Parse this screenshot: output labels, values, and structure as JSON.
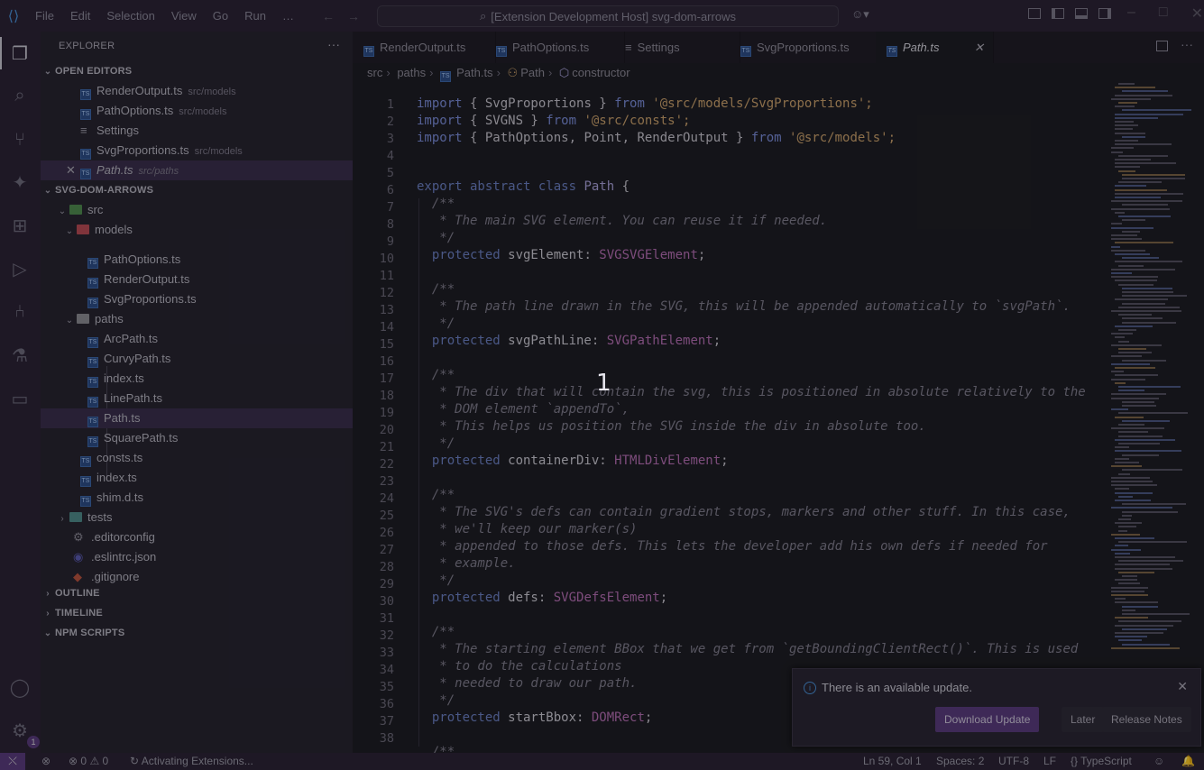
{
  "titlebar": {
    "menu": [
      "File",
      "Edit",
      "Selection",
      "View",
      "Go",
      "Run",
      "…"
    ],
    "search": "[Extension Development Host] svg-dom-arrows"
  },
  "explorer": {
    "title": "EXPLORER",
    "open_editors_label": "OPEN EDITORS",
    "open_editors": [
      {
        "name": "RenderOutput.ts",
        "path": "src/models"
      },
      {
        "name": "PathOptions.ts",
        "path": "src/models"
      },
      {
        "name": "Settings",
        "path": ""
      },
      {
        "name": "SvgProportions.ts",
        "path": "src/models"
      },
      {
        "name": "Path.ts",
        "path": "src/paths"
      }
    ],
    "project_label": "SVG-DOM-ARROWS",
    "tree": {
      "src": "src",
      "models": "models",
      "models_files": [
        "PathOptions.ts",
        "RenderOutput.ts",
        "SvgProportions.ts"
      ],
      "paths": "paths",
      "paths_files": [
        "ArcPath.ts",
        "CurvyPath.ts",
        "index.ts",
        "LinePath.ts",
        "Path.ts",
        "SquarePath.ts"
      ],
      "src_files": [
        "consts.ts",
        "index.ts",
        "shim.d.ts"
      ],
      "tests": "tests",
      "root_files": [
        ".editorconfig",
        ".eslintrc.json",
        ".gitignore"
      ]
    },
    "outline": "OUTLINE",
    "timeline": "TIMELINE",
    "npm_scripts": "NPM SCRIPTS"
  },
  "tabs": [
    {
      "label": "RenderOutput.ts"
    },
    {
      "label": "PathOptions.ts"
    },
    {
      "label": "Settings"
    },
    {
      "label": "SvgProportions.ts"
    },
    {
      "label": "Path.ts"
    }
  ],
  "breadcrumb": [
    "src",
    "paths",
    "Path.ts",
    "Path",
    "constructor"
  ],
  "code": {
    "line_numbers": [
      "1",
      "2",
      "3",
      "4",
      "5",
      "6",
      "7",
      "8",
      "9",
      "10",
      "11",
      "12",
      "13",
      "14",
      "15",
      "16",
      "17",
      "18",
      "19",
      "20",
      "21",
      "22",
      "23",
      "24",
      "25",
      "26",
      "27",
      "28",
      "29",
      "30",
      "31",
      "32",
      "33",
      "34",
      "35",
      "36",
      "37",
      "38"
    ],
    "l1": [
      "import",
      " { SvgProportions } ",
      "from",
      " '@src/models/SvgProportions';"
    ],
    "l2": [
      "import",
      " { SVGNS } ",
      "from",
      " '@src/consts';"
    ],
    "l3": [
      "import",
      " { PathOptions, Point, RenderOutput } ",
      "from",
      " '@src/models';"
    ],
    "l5": [
      "export",
      " abstract",
      " class",
      " Path",
      " {"
    ],
    "c6": "  /**",
    "c7": "   * The main SVG element. You can reuse it if needed.",
    "c8": "   */",
    "p9": [
      "  protected",
      " svgElement",
      ": ",
      "SVGSVGElement",
      ";"
    ],
    "c11": "  /**",
    "c12": "   * The path line drawn in the SVG, this will be appended automatically to `svgPath`.",
    "c13": "   */",
    "p14": [
      "  protected",
      " svgPathLine",
      ": ",
      "SVGPathElement",
      ";"
    ],
    "c16": "  /**",
    "c17": "   * The div that will contain the svg, this is positioned in absolute relatively to the",
    "c18": "   * DOM element `appendTo`,",
    "c19": "   * This helps us position the SVG inside the div in absolute too.",
    "c20": "   */",
    "p21": [
      "  protected",
      " containerDiv",
      ": ",
      "HTMLDivElement",
      ";"
    ],
    "c23": "  /**",
    "c24": "   * The SVG's defs can contain gradient stops, markers and other stuff. In this case,",
    "c25": "   * we'll keep our marker(s)",
    "c26": "   * appended to those defs. This lets the developer add his own defs if needed for",
    "c27": "   * example.",
    "c28": "   */",
    "p29": [
      "  protected",
      " defs",
      ": ",
      "SVGDefsElement",
      ";"
    ],
    "c31": "  /**",
    "c32": "   * The starting element BBox that we get from `getBoundingClientRect()`. This is used",
    "c33": "   * to do the calculations",
    "c34": "   * needed to draw our path.",
    "c35": "   */",
    "p36": [
      "  protected",
      " startBbox",
      ": ",
      "DOMRect",
      ";"
    ],
    "c38": "  /**"
  },
  "overlay_number": "1",
  "notification": {
    "message": "There is an available update.",
    "primary": "Download Update",
    "later": "Later",
    "notes": "Release Notes"
  },
  "status": {
    "errors": "0",
    "warnings": "0",
    "activity": "Activating Extensions...",
    "position": "Ln 59, Col 1",
    "spaces": "Spaces: 2",
    "encoding": "UTF-8",
    "eol": "LF",
    "language": "TypeScript"
  },
  "activity_badge": "1"
}
